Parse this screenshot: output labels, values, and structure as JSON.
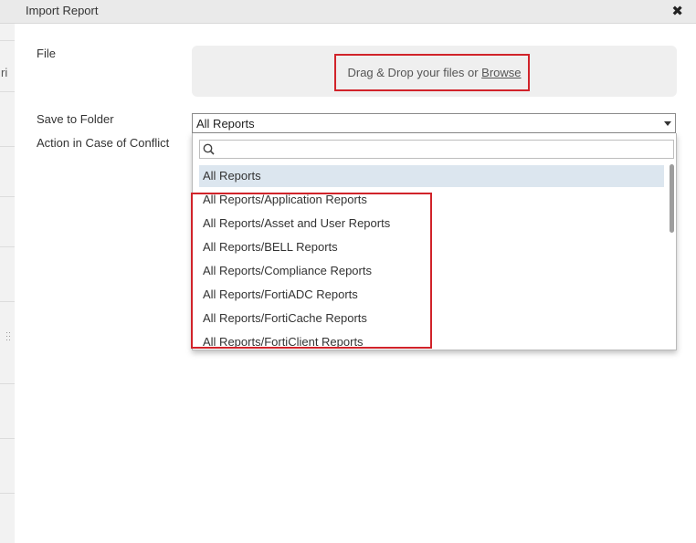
{
  "dialog": {
    "title": "Import Report",
    "close_glyph": "✖"
  },
  "background": {
    "fragment_text": "ri"
  },
  "form": {
    "file_label": "File",
    "save_folder_label": "Save to Folder",
    "conflict_label": "Action in Case of Conflict"
  },
  "dropzone": {
    "text_prefix": "Drag & Drop your files or ",
    "browse_label": "Browse"
  },
  "folder_select": {
    "value": "All Reports",
    "search_placeholder": "",
    "options": [
      "All Reports",
      "All Reports/Application Reports",
      "All Reports/Asset and User Reports",
      "All Reports/BELL Reports",
      "All Reports/Compliance Reports",
      "All Reports/FortiADC Reports",
      "All Reports/FortiCache Reports",
      "All Reports/FortiClient Reports"
    ],
    "selected_index": 0
  },
  "colors": {
    "highlight": "#d1232a",
    "selected_option_bg": "#dce6ef"
  },
  "icons": {
    "search": "search-icon",
    "close": "close-icon",
    "caret": "chevron-down-icon",
    "grip": "drag-handle-icon"
  }
}
